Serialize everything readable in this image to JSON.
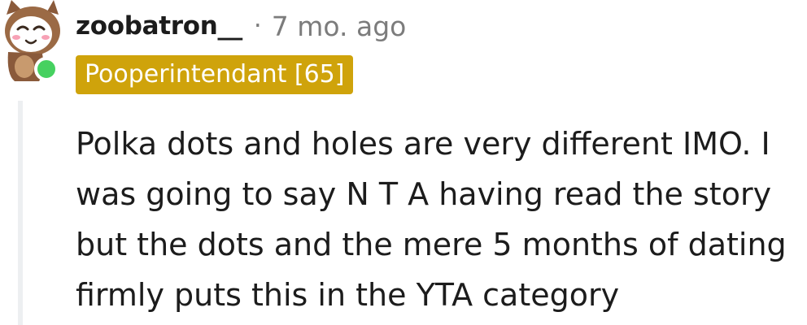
{
  "comment": {
    "username": "zoobatron__",
    "separator": "·",
    "timestamp": "7 mo. ago",
    "flair": "Pooperintendant [65]",
    "body": "Polka dots and holes are very different IMO. I was going to say N T A having read the story but the dots and the mere 5 months of dating firmly puts this in the YTA category",
    "online": true
  },
  "colors": {
    "flair_bg": "#cfa30b",
    "online_dot": "#46d160",
    "meta_text": "#7c7c7c",
    "body_text": "#1c1c1c"
  },
  "icons": {
    "avatar": "owl-avatar-icon",
    "status": "online-status-icon"
  }
}
